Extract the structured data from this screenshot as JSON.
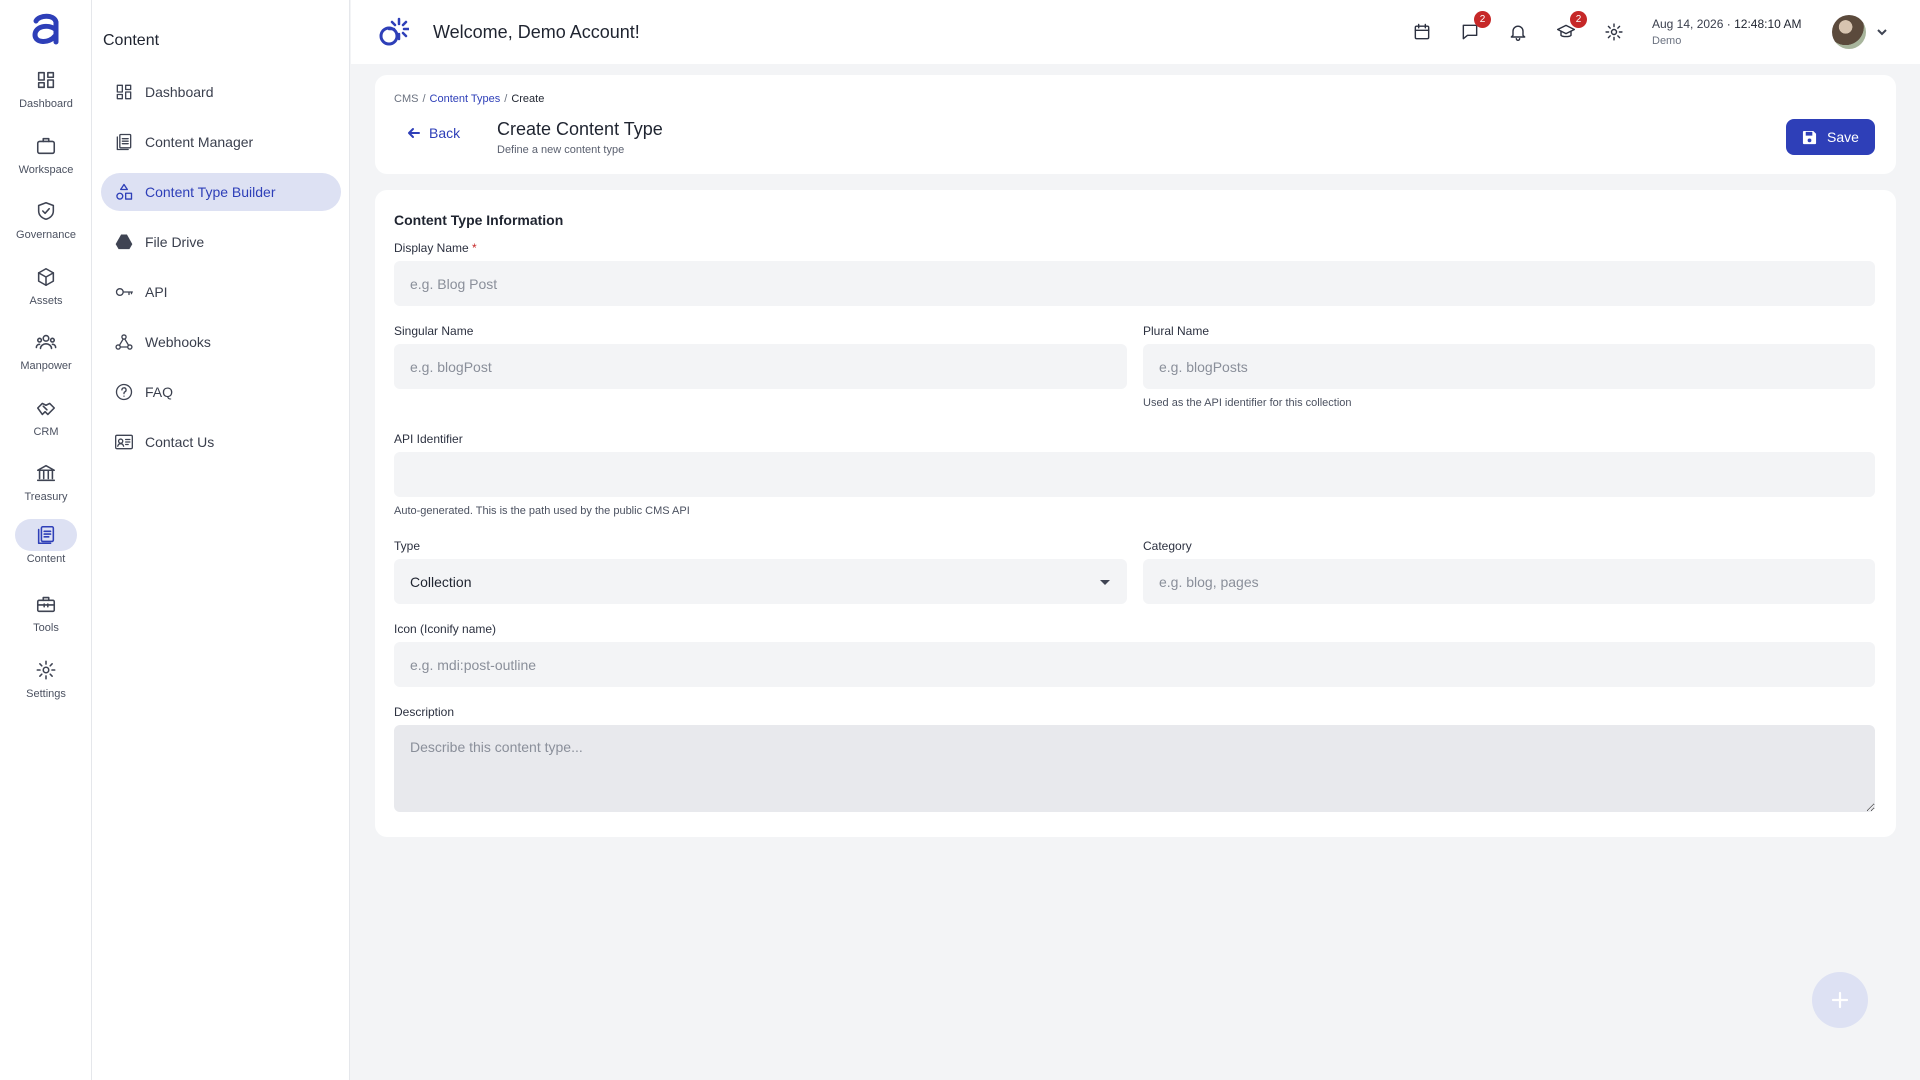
{
  "rail": {
    "items": [
      {
        "label": "Dashboard",
        "icon": "dashboard-icon"
      },
      {
        "label": "Workspace",
        "icon": "briefcase-icon"
      },
      {
        "label": "Governance",
        "icon": "shield-check-icon"
      },
      {
        "label": "Assets",
        "icon": "cube-icon"
      },
      {
        "label": "Manpower",
        "icon": "people-icon"
      },
      {
        "label": "CRM",
        "icon": "handshake-icon"
      },
      {
        "label": "Treasury",
        "icon": "bank-icon"
      },
      {
        "label": "Content",
        "icon": "content-icon",
        "active": true
      },
      {
        "label": "Tools",
        "icon": "toolbox-icon"
      },
      {
        "label": "Settings",
        "icon": "gear-icon"
      }
    ]
  },
  "sidebar": {
    "title": "Content",
    "items": [
      {
        "label": "Dashboard",
        "icon": "dashboard-icon"
      },
      {
        "label": "Content Manager",
        "icon": "content-manager-icon"
      },
      {
        "label": "Content Type Builder",
        "icon": "shapes-icon",
        "active": true
      },
      {
        "label": "File Drive",
        "icon": "drive-icon"
      },
      {
        "label": "API",
        "icon": "key-icon"
      },
      {
        "label": "Webhooks",
        "icon": "webhook-icon"
      },
      {
        "label": "FAQ",
        "icon": "help-circle-icon"
      },
      {
        "label": "Contact Us",
        "icon": "contact-card-icon"
      }
    ]
  },
  "topbar": {
    "welcome": "Welcome, Demo Account!",
    "messages_badge": "2",
    "learning_badge": "2",
    "date": "Aug 14, 2026",
    "separator": "·",
    "time": "12:48:10 AM",
    "user": "Demo"
  },
  "header": {
    "breadcrumb": {
      "root": "CMS",
      "sep": "/",
      "link": "Content Types",
      "current": "Create"
    },
    "back_label": "Back",
    "title": "Create Content Type",
    "subtitle": "Define a new content type",
    "save_label": "Save"
  },
  "form": {
    "section_title": "Content Type Information",
    "display_name": {
      "label": "Display Name",
      "required_mark": "*",
      "placeholder": "e.g. Blog Post",
      "value": ""
    },
    "singular_name": {
      "label": "Singular Name",
      "placeholder": "e.g. blogPost",
      "value": ""
    },
    "plural_name": {
      "label": "Plural Name",
      "placeholder": "e.g. blogPosts",
      "value": "",
      "help": "Used as the API identifier for this collection"
    },
    "api_identifier": {
      "label": "API Identifier",
      "value": "",
      "help": "Auto-generated. This is the path used by the public CMS API"
    },
    "type": {
      "label": "Type",
      "value": "Collection"
    },
    "category": {
      "label": "Category",
      "placeholder": "e.g. blog, pages",
      "value": ""
    },
    "icon": {
      "label": "Icon (Iconify name)",
      "placeholder": "e.g. mdi:post-outline",
      "value": ""
    },
    "description": {
      "label": "Description",
      "placeholder": "Describe this content type...",
      "value": ""
    }
  },
  "colors": {
    "accent": "#2e3fb8",
    "badge": "#c62828",
    "active_bg": "#dde1f3"
  }
}
